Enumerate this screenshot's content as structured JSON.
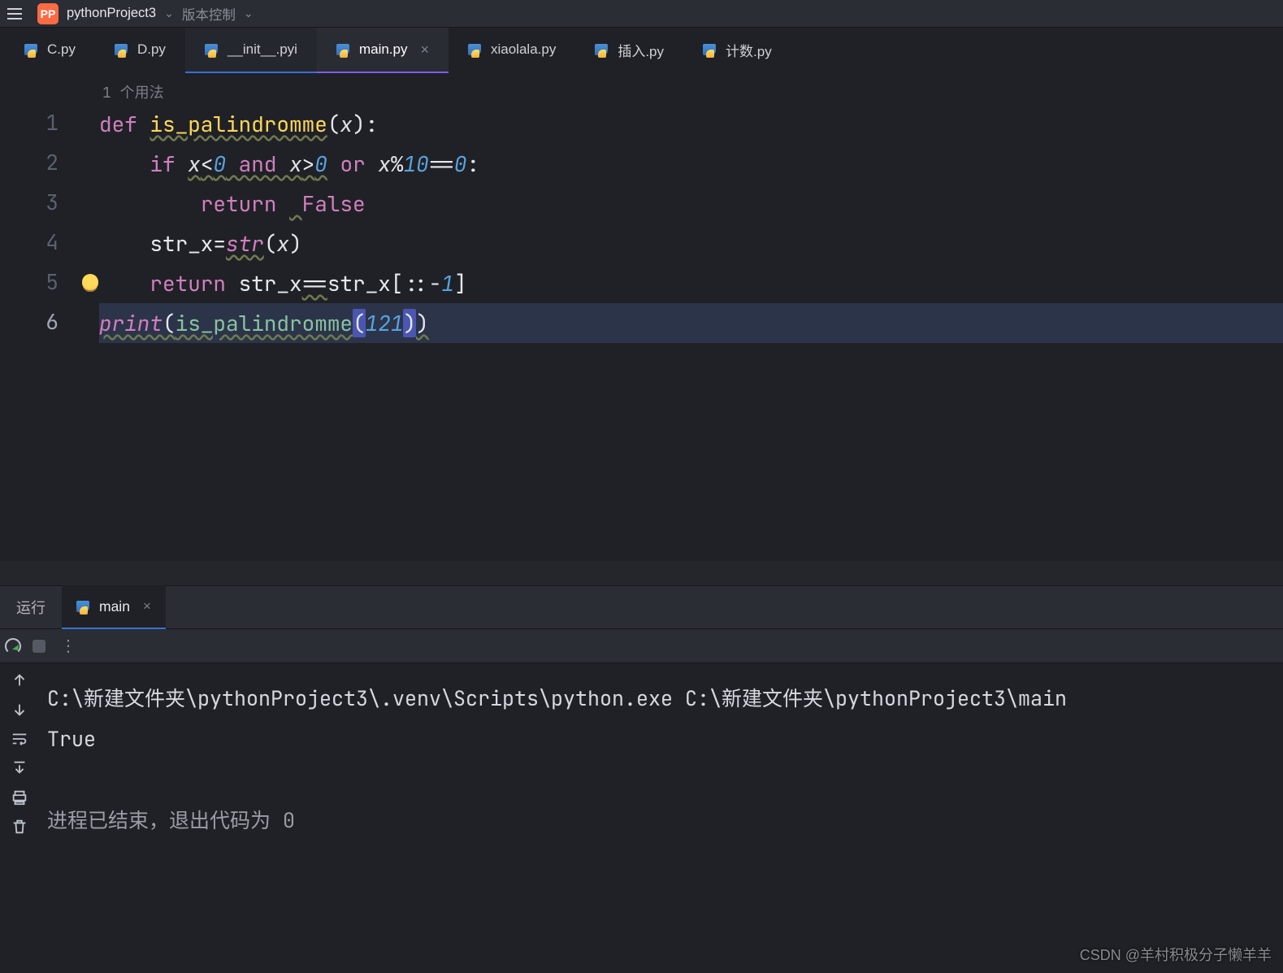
{
  "topbar": {
    "project_name": "pythonProject3",
    "vcs_label": "版本控制"
  },
  "tabs": [
    {
      "label": "C.py"
    },
    {
      "label": "D.py"
    },
    {
      "label": "__init__.pyi"
    },
    {
      "label": "main.py",
      "closable": true,
      "active": true
    },
    {
      "label": "xiaolala.py"
    },
    {
      "label": "插入.py"
    },
    {
      "label": "计数.py"
    }
  ],
  "editor": {
    "usages": "1 个用法",
    "line_numbers": [
      "1",
      "2",
      "3",
      "4",
      "5",
      "6"
    ]
  },
  "code": {
    "l1_def": "def ",
    "l1_name": "is_palindromme",
    "l1_p1": "(",
    "l1_x": "x",
    "l1_p2": "):",
    "l2_pre": "    ",
    "l2_if": "if ",
    "l2_x1": "x",
    "l2_lt": "<",
    "l2_z1": "0",
    "l2_and": " and ",
    "l2_x2": "x",
    "l2_gt": ">",
    "l2_z2": "0",
    "l2_or": " or ",
    "l2_x3": "x",
    "l2_mod": "%",
    "l2_ten": "10",
    "l2_eq1": "==",
    "l2_z3": "0",
    "l2_colon": ":",
    "l3_pre": "        ",
    "l3_ret": "return ",
    "l3_sp": " ",
    "l3_false": "False",
    "l4_pre": "    ",
    "l4_strx": "str_x",
    "l4_eq": "=",
    "l4_str": "str",
    "l4_p1": "(",
    "l4_x": "x",
    "l4_p2": ")",
    "l5_pre": "    ",
    "l5_ret": "return ",
    "l5_s1": "str_x",
    "l5_eq": "==",
    "l5_s2": "str_x",
    "l5_br1": "[",
    "l5_c1": ":",
    "l5_c2": ":",
    "l5_n1": "-",
    "l5_one": "1",
    "l5_br2": "]",
    "l6_print": "print",
    "l6_p1": "(",
    "l6_call": "is_palindromme",
    "l6_p2": "(",
    "l6_arg": "121",
    "l6_p3": ")",
    "l6_p4": ")"
  },
  "runbar": {
    "label": "运行",
    "tab": "main"
  },
  "console": {
    "cmd": "C:\\新建文件夹\\pythonProject3\\.venv\\Scripts\\python.exe C:\\新建文件夹\\pythonProject3\\main",
    "out": "True",
    "exit": "进程已结束，退出代码为 0"
  },
  "watermark": "CSDN @羊村积极分子懒羊羊"
}
